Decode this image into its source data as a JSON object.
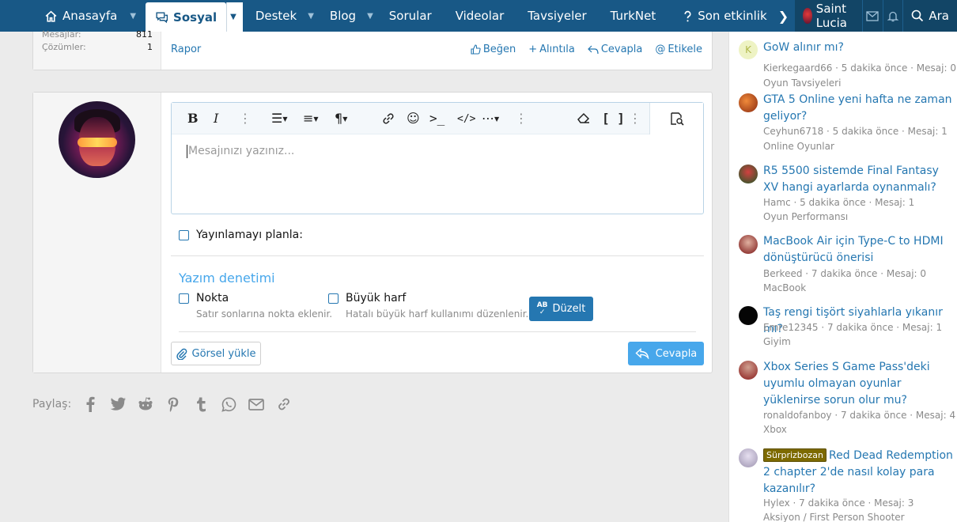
{
  "nav": {
    "items": [
      {
        "label": "Anasayfa",
        "icon": "home-icon"
      },
      {
        "label": "Sosyal",
        "icon": "chat-icon",
        "active": true
      },
      {
        "label": "Destek"
      },
      {
        "label": "Blog"
      },
      {
        "label": "Sorular"
      },
      {
        "label": "Videolar"
      },
      {
        "label": "Tavsiyeler"
      },
      {
        "label": "TurkNet"
      },
      {
        "label": "Son etkinlik",
        "icon": "question-icon"
      }
    ],
    "user": "Saint Lucia",
    "search_label": "Ara"
  },
  "prev_post": {
    "stats": [
      {
        "label": "Mesajlar:",
        "value": "811"
      },
      {
        "label": "Çözümler:",
        "value": "1"
      }
    ],
    "report": "Rapor",
    "actions": {
      "like": "Beğen",
      "quote": "Alıntıla",
      "reply": "Cevapla",
      "tag": "Etikele"
    }
  },
  "editor": {
    "placeholder": "Mesajınızı yazınız...",
    "schedule_label": "Yayınlamayı planla:",
    "spell": {
      "title": "Yazım denetimi",
      "opt1": {
        "label": "Nokta",
        "desc": "Satır sonlarına nokta eklenir."
      },
      "opt2": {
        "label": "Büyük harf",
        "desc": "Hatalı büyük harf kullanımı düzenlenir."
      },
      "fix_button": "Düzelt",
      "fix_icon_text": "AB"
    },
    "upload_button": "Görsel yükle",
    "submit_button": "Cevapla"
  },
  "share": {
    "label": "Paylaş:"
  },
  "sidebar": {
    "threads": [
      {
        "title": "GoW alınır mı?",
        "meta": "Kierkegaard66 · 5 dakika önce · Mesaj: 0",
        "forum": "Oyun Tavsiyeleri",
        "avatar_letter": "K",
        "avatar_color": "#eef3c4"
      },
      {
        "title": "GTA 5 Online yeni hafta ne zaman geliyor?",
        "meta": "Ceyhun6718 · 5 dakika önce · Mesaj: 1",
        "forum": "Online Oyunlar",
        "avatar_color": "#b84a1a"
      },
      {
        "title": "R5 5500 sistemde Final Fantasy XV hangi ayarlarda oynanmalı?",
        "meta": "Hamc · 5 dakika önce · Mesaj: 1",
        "forum": "Oyun Performansı",
        "avatar_color": "#2f7a3a"
      },
      {
        "title": "MacBook Air için Type-C to HDMI dönüştürücü önerisi",
        "meta": "Berkeed · 7 dakika önce · Mesaj: 0",
        "forum": "MacBook",
        "avatar_color": "#8a1d1d"
      },
      {
        "title": "Taş rengi tişört siyahlarla yıkanır mı?",
        "meta": "Emre12345 · 7 dakika önce · Mesaj: 1",
        "forum": "Giyim",
        "avatar_color": "#050505"
      },
      {
        "title": "Xbox Series S Game Pass'deki uyumlu olmayan oyunlar yüklenirse sorun olur mu?",
        "meta": "ronaldofanboy · 7 dakika önce · Mesaj: 4",
        "forum": "Xbox",
        "avatar_color": "#9c1f1f"
      },
      {
        "badge": "Sürprizbozan",
        "title": "Red Dead Redemption 2 chapter 2'de nasıl kolay para kazanılır?",
        "meta": "Hylex · 7 dakika önce · Mesaj: 3",
        "forum": "Aksiyon / First Person Shooter",
        "avatar_color": "#b7aec7"
      }
    ]
  }
}
